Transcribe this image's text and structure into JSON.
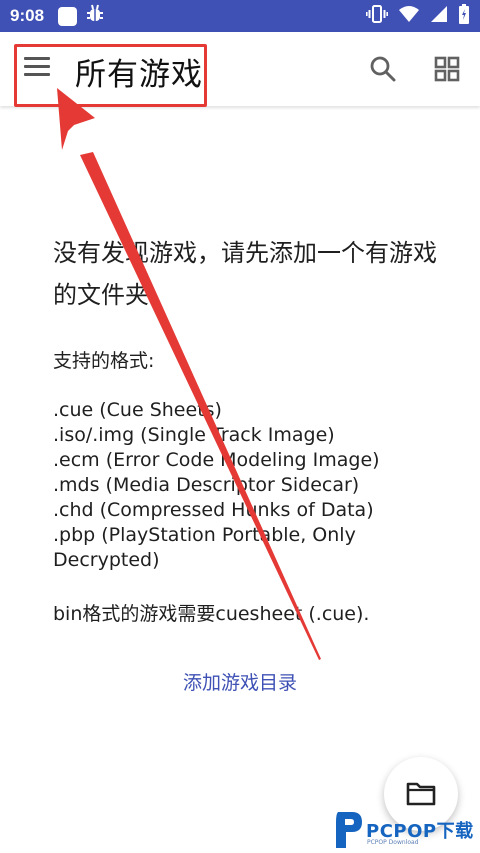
{
  "status_bar": {
    "time": "9:08",
    "icons": [
      "square-app-icon",
      "bug-icon",
      "vibrate-icon",
      "wifi-icon",
      "signal-icon",
      "battery-icon"
    ]
  },
  "app_bar": {
    "title": "所有游戏",
    "icons": [
      "menu-icon",
      "search-icon",
      "grid-view-icon"
    ]
  },
  "empty_state": {
    "title": "没有发现游戏，请先添加一个有游戏的文件夹",
    "formats_heading": "支持的格式:",
    "formats": [
      ".cue (Cue Sheets)",
      ".iso/.img (Single Track Image)",
      ".ecm (Error Code Modeling Image)",
      ".mds (Media Descriptor Sidecar)",
      ".chd (Compressed Hunks of Data)",
      ".pbp (PlayStation Portable, Only Decrypted)"
    ],
    "bin_note": "bin格式的游戏需要cuesheet (.cue).",
    "add_directory_label": "添加游戏目录"
  },
  "fab": {
    "icon": "folder-icon"
  },
  "watermark": {
    "brand": "PCPOP下载",
    "subtext": "PCPOP Download"
  },
  "colors": {
    "status_bar": "#3f51b5",
    "accent": "#3f51b5",
    "annotation": "#e53935",
    "watermark": "#1565c0"
  }
}
